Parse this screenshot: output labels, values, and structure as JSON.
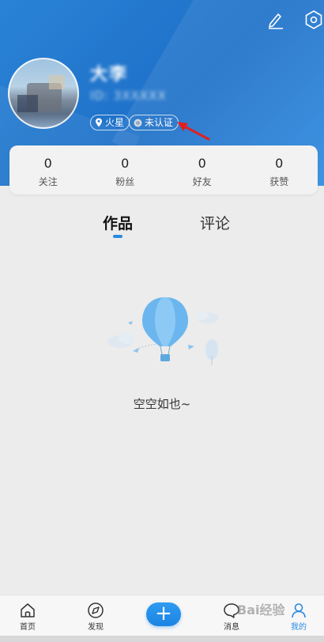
{
  "header": {
    "username": "大李",
    "user_id": "ID: 3XXXXX",
    "location_tag": "火星",
    "verify_tag": "未认证"
  },
  "stats": [
    {
      "count": "0",
      "label": "关注"
    },
    {
      "count": "0",
      "label": "粉丝"
    },
    {
      "count": "0",
      "label": "好友"
    },
    {
      "count": "0",
      "label": "获赞"
    }
  ],
  "tabs": [
    {
      "label": "作品",
      "active": true
    },
    {
      "label": "评论",
      "active": false
    }
  ],
  "empty_state": {
    "text": "空空如也~"
  },
  "bottom_nav": [
    {
      "label": "首页",
      "icon": "home-icon"
    },
    {
      "label": "发现",
      "icon": "compass-icon"
    },
    {
      "label": "+",
      "icon": "plus-icon"
    },
    {
      "label": "消息",
      "icon": "chat-bubble-icon"
    },
    {
      "label": "我的",
      "icon": "user-icon",
      "active": true
    }
  ],
  "watermark": "Bai经验",
  "colors": {
    "accent": "#2b8ae0",
    "header": "#1e70c8",
    "annotation_arrow": "#e02020"
  }
}
